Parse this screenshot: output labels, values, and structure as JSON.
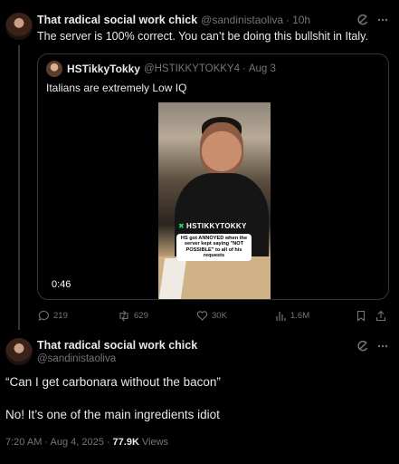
{
  "reply_tweet": {
    "display_name": "That radical social work chick",
    "handle": "@sandinistaoliva",
    "separator": "·",
    "time": "10h",
    "text": "The server is 100% correct. You can’t be doing this bullshit in Italy.",
    "quoted": {
      "display_name": "HSTikkyTokky",
      "handle": "@HSTIKKYTOKKY4",
      "separator": "·",
      "time": "Aug 3",
      "text": "Italians are extremely Low IQ",
      "video": {
        "watermark": "HSTIKKYTOKKY",
        "caption": "HS got ANNOYED when the server kept saying \"NOT POSSIBLE\" to all of his requests",
        "duration": "0:46"
      }
    },
    "metrics": {
      "replies": "219",
      "reposts": "629",
      "likes": "30K",
      "views": "1.6M"
    },
    "icons": [
      "grok-icon",
      "more-icon",
      "reply-icon",
      "repost-icon",
      "like-icon",
      "views-icon",
      "bookmark-icon",
      "share-icon"
    ]
  },
  "main_tweet": {
    "display_name": "That radical social work chick",
    "handle": "@sandinistaoliva",
    "line1": "“Can I get carbonara without the bacon”",
    "line2": "No! It’s one of the main ingredients idiot",
    "timestamp": "7:20 AM · Aug 4, 2025",
    "dot": "·",
    "views_count": "77.9K",
    "views_label": "Views"
  },
  "colors": {
    "background": "#000000",
    "text": "#e7e9ea",
    "muted": "#71767b",
    "border": "#333639",
    "watermark_x": "#29d36b"
  }
}
